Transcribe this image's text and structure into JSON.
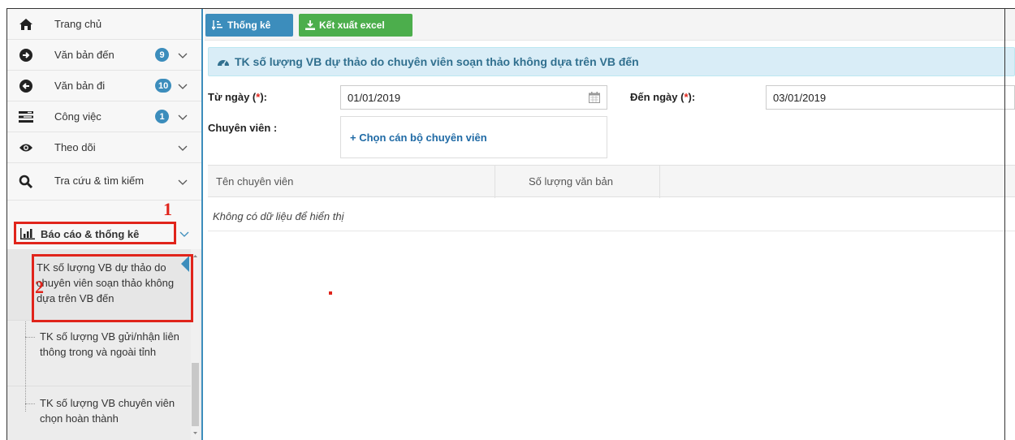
{
  "sidebar": {
    "items": [
      {
        "label": "Trang chủ",
        "icon": "home-icon",
        "badge": null
      },
      {
        "label": "Văn bản đến",
        "icon": "arrow-circle-right-icon",
        "badge": "9"
      },
      {
        "label": "Văn bản đi",
        "icon": "arrow-circle-left-icon",
        "badge": "10"
      },
      {
        "label": "Công việc",
        "icon": "tasks-icon",
        "badge": "1"
      },
      {
        "label": "Theo dõi",
        "icon": "eye-icon",
        "badge": null
      },
      {
        "label": "Tra cứu & tìm kiếm",
        "icon": "search-icon",
        "badge": null
      },
      {
        "label": "Báo cáo & thống kê",
        "icon": "bar-chart-icon",
        "badge": null
      }
    ],
    "submenu": [
      {
        "label": "TK số lượng VB dự thảo do chuyên viên soạn thảo không dựa trên VB đến",
        "active": true
      },
      {
        "label": "TK số lượng VB gửi/nhận liên thông trong và ngoài tỉnh",
        "active": false
      },
      {
        "label": "TK số lượng VB chuyên viên chọn hoàn thành",
        "active": false
      }
    ]
  },
  "annotations": {
    "one": "1",
    "two": "2"
  },
  "toolbar": {
    "stats_label": "Thống kê",
    "export_label": "Kết xuất excel"
  },
  "panel": {
    "title": "TK số lượng VB dự thảo do chuyên viên soạn thảo không dựa trên VB đến"
  },
  "form": {
    "from_label": "Từ ngày",
    "to_label": "Đến ngày",
    "required_mark": "*",
    "from_value": "01/01/2019",
    "to_value": "03/01/2019",
    "staff_label": "Chuyên viên :",
    "staff_pick": "+ Chọn cán bộ chuyên viên"
  },
  "grid": {
    "columns": [
      "Tên chuyên viên",
      "Số lượng văn bản"
    ],
    "empty_text": "Không có dữ liệu để hiển thị"
  },
  "colors": {
    "primary": "#3c8dbc",
    "success": "#4cae4c",
    "annotation": "#e0241b",
    "panel_bg": "#d9edf7"
  }
}
